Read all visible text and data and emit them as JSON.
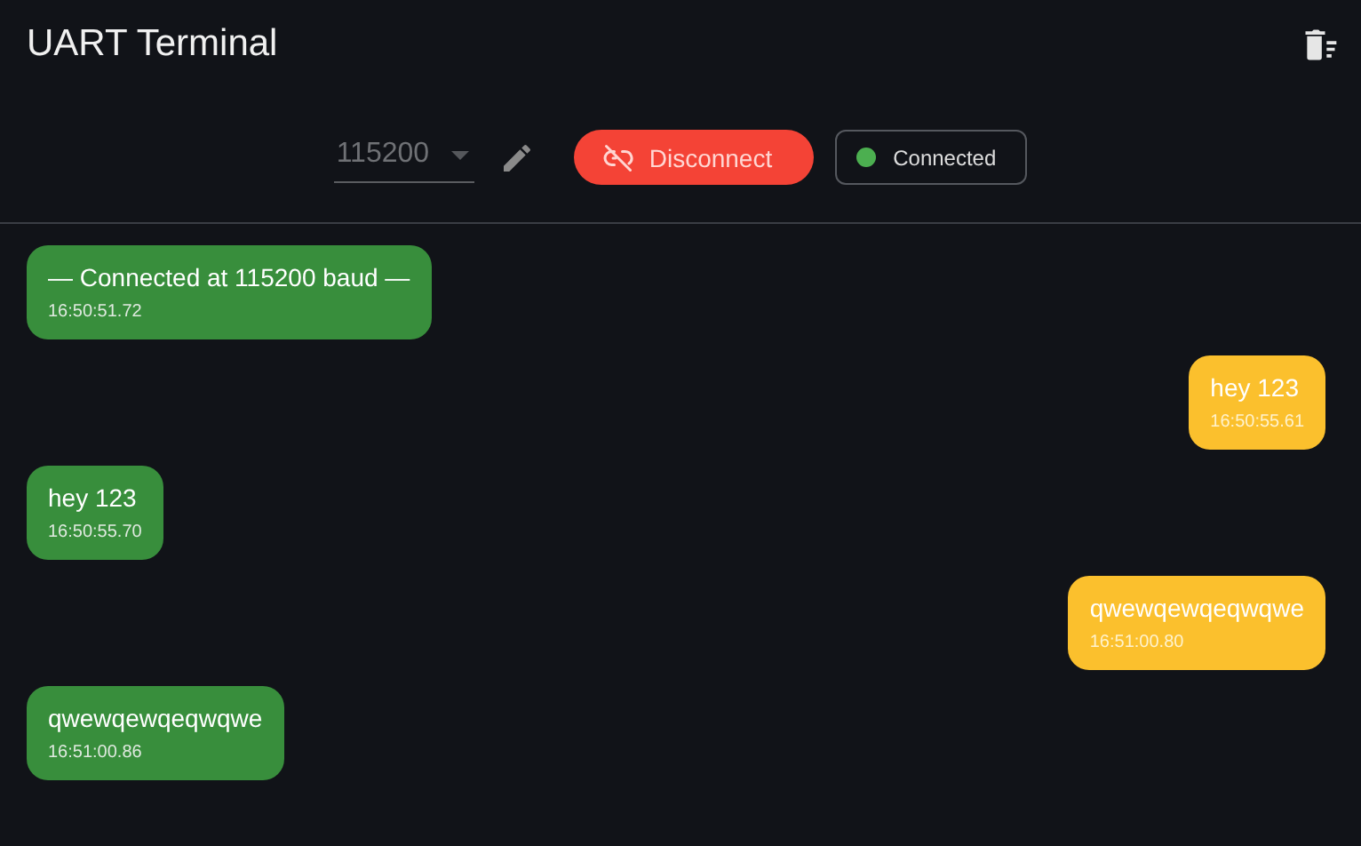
{
  "app_bar": {
    "title": "UART Terminal"
  },
  "toolbar": {
    "baud": {
      "value": "115200",
      "disabled": true
    },
    "connect_button": {
      "label": "Disconnect",
      "connected": true
    },
    "status": {
      "label": "Connected",
      "color": "#4caf50"
    }
  },
  "messages": [
    {
      "kind": "received",
      "text": "— Connected at 115200 baud —",
      "time": "16:50:51.72"
    },
    {
      "kind": "sent",
      "text": "hey 123",
      "time": "16:50:55.61"
    },
    {
      "kind": "received",
      "text": "hey 123",
      "time": "16:50:55.70"
    },
    {
      "kind": "sent",
      "text": "qwewqewqeqwqwe",
      "time": "16:51:00.80"
    },
    {
      "kind": "received",
      "text": "qwewqewqeqwqwe",
      "time": "16:51:00.86"
    }
  ]
}
